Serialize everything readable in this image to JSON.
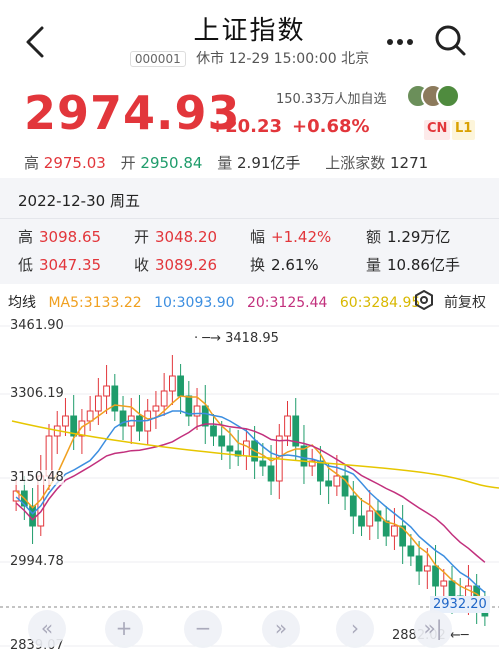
{
  "header": {
    "title": "上证指数",
    "code": "000001",
    "status": "休市 12-29 15:00:00 北京"
  },
  "quote": {
    "price": "2974.93",
    "change": "+20.23",
    "change_pct": "+0.68%",
    "watchers": "150.33万人加自选",
    "badge_cn": "CN",
    "badge_l1": "L1"
  },
  "stats": {
    "high_label": "高",
    "high": "2975.03",
    "open_label": "开",
    "open": "2950.84",
    "vol_label": "量",
    "vol": "2.91亿手",
    "up_label": "上涨家数",
    "up": "1271"
  },
  "detail": {
    "date": "2022-12-30 周五",
    "rows": [
      [
        {
          "k": "高",
          "v": "3098.65",
          "c": "#e2363b"
        },
        {
          "k": "开",
          "v": "3048.20",
          "c": "#e2363b"
        },
        {
          "k": "幅",
          "v": "+1.42%",
          "c": "#e2363b"
        },
        {
          "k": "额",
          "v": "1.29万亿",
          "c": "#222"
        }
      ],
      [
        {
          "k": "低",
          "v": "3047.35",
          "c": "#e2363b"
        },
        {
          "k": "收",
          "v": "3089.26",
          "c": "#e2363b"
        },
        {
          "k": "换",
          "v": "2.61%",
          "c": "#222"
        },
        {
          "k": "量",
          "v": "10.86亿手",
          "c": "#222"
        }
      ]
    ]
  },
  "indicators": {
    "title": "均线",
    "ma5": "MA5:3133.22",
    "ma10": "10:3093.90",
    "ma20": "20:3125.44",
    "ma60": "60:3284.95",
    "restore": "前复权",
    "colors": {
      "ma5": "#f0a020",
      "ma10": "#3c8ee0",
      "ma20": "#c2307d",
      "ma60": "#e6c600",
      "up": "#e2363b",
      "down": "#1f9c6b"
    }
  },
  "chart": {
    "y_labels": [
      "3461.90",
      "3306.19",
      "3150.48",
      "2994.78",
      "2839.07"
    ],
    "high_marker": "3418.95",
    "low_marker": "2882.02",
    "last_tag": "2932.20"
  },
  "controls": [
    "«",
    "+",
    "−",
    "»",
    "›",
    "»|"
  ]
}
